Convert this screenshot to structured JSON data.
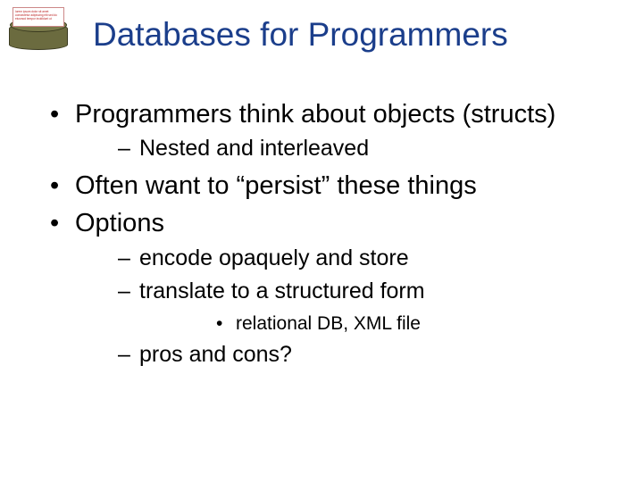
{
  "title": "Databases for Programmers",
  "bullets": {
    "b0": "Programmers think about objects (structs)",
    "b0s0": "Nested and interleaved",
    "b1": "Often want to “persist” these things",
    "b2": "Options",
    "b2s0": "encode opaquely and store",
    "b2s1": "translate to a structured form",
    "b2s1s0": "relational DB, XML file",
    "b2s2": "pros and cons?"
  },
  "logo_text": "lorem ipsum dolor sit amet consectetur adipiscing elit sed do eiusmod tempor incididunt ut"
}
